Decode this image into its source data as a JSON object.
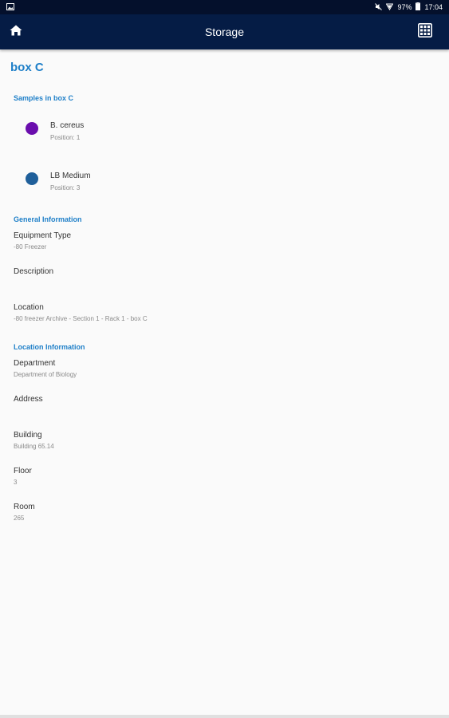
{
  "status_bar": {
    "left_icon": "image-icon",
    "mute_icon": "mute-icon",
    "signal_icon": "signal-icon",
    "battery": "97%",
    "battery_icon": "battery-icon",
    "time": "17:04"
  },
  "app_bar": {
    "title": "Storage",
    "home_icon": "home-icon",
    "grid_icon": "grid-icon"
  },
  "page": {
    "title": "box C"
  },
  "samples_section": {
    "header": "Samples in box C",
    "items": [
      {
        "name": "B. cereus",
        "position": "Position: 1",
        "color": "#6a0dad"
      },
      {
        "name": "LB Medium",
        "position": "Position: 3",
        "color": "#1f5f9a"
      }
    ]
  },
  "general_section": {
    "header": "General Information",
    "equipment_type": {
      "label": "Equipment Type",
      "value": "-80 Freezer"
    },
    "description": {
      "label": "Description",
      "value": ""
    },
    "location": {
      "label": "Location",
      "value": "-80 freezer Archive - Section 1 - Rack 1 - box C"
    }
  },
  "location_section": {
    "header": "Location Information",
    "department": {
      "label": "Department",
      "value": "Department of Biology"
    },
    "address": {
      "label": "Address",
      "value": ""
    },
    "building": {
      "label": "Building",
      "value": "Building 65.14"
    },
    "floor": {
      "label": "Floor",
      "value": "3"
    },
    "room": {
      "label": "Room",
      "value": "265"
    }
  }
}
